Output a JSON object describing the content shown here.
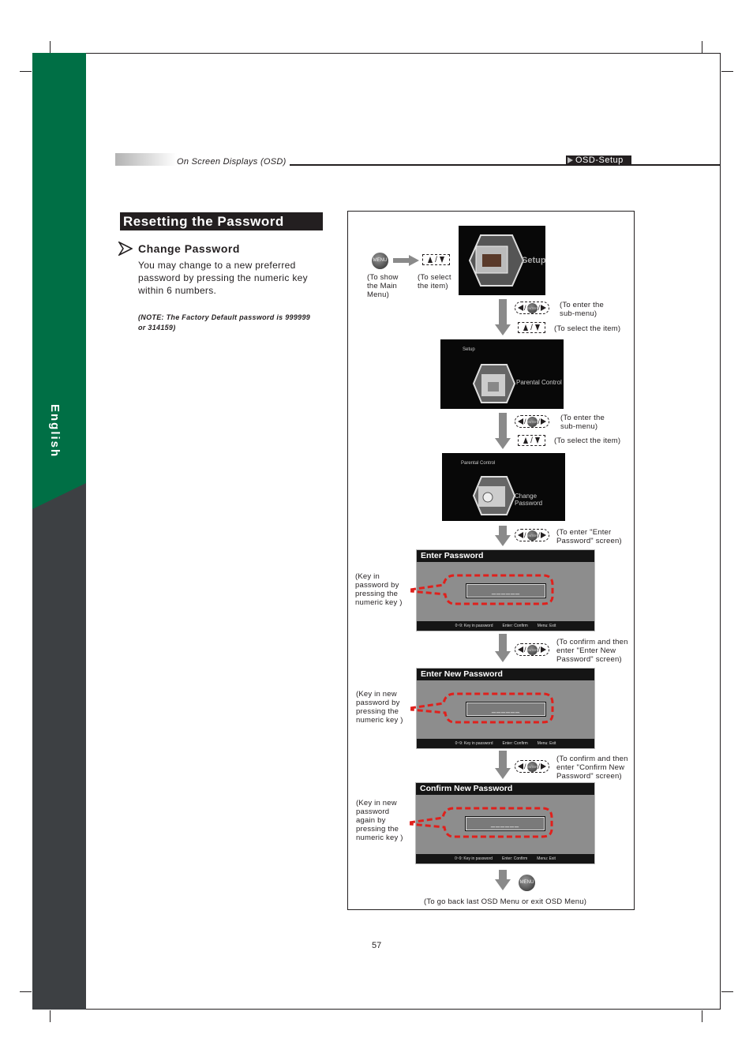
{
  "header": {
    "section": "On Screen Displays (OSD)",
    "tag": "OSD-Setup"
  },
  "sidebar": {
    "language": "English"
  },
  "colors": {
    "green": "#006f45",
    "dark": "#3d4043",
    "dashed_callout": "#e0201c"
  },
  "section": {
    "title": "Resetting the Password",
    "subtitle": "Change Password",
    "body": "You may change to a new preferred password by pressing the numeric key within 6 numbers.",
    "note": "(NOTE: The Factory Default password is 999999 or 314159)"
  },
  "diagram": {
    "menu_key": "MENU",
    "enter_key": "ENTER",
    "cap_show_main": "(To show the Main Menu)",
    "cap_select_item": "(To select the item)",
    "cap_enter_sub": "(To enter the sub-menu)",
    "cap_select_item2": "(To select the item)",
    "cap_enter_sub2": "(To enter the sub-menu)",
    "cap_select_item3": "(To select the item)",
    "cap_enter_pw": "(To enter \"Enter Password\" screen)",
    "cap_confirm_new": "(To confirm and then enter \"Enter New Password\" screen)",
    "cap_confirm_confirm": "(To confirm and then enter \"Confirm New Password\" screen)",
    "cap_exit": "(To go back last OSD Menu or exit OSD Menu)",
    "screens": {
      "setup": {
        "label": "Setup"
      },
      "parental": {
        "parent": "Setup",
        "label": "Parental Control"
      },
      "change": {
        "parent": "Parental Control",
        "label": "Change Password"
      }
    },
    "pw_screens": [
      {
        "title": "Enter Password",
        "callout": "(Key in password by pressing the numeric key )"
      },
      {
        "title": "Enter New Password",
        "callout": "(Key in new password by pressing the numeric key )"
      },
      {
        "title": "Confirm New Password",
        "callout": "(Key in new password again by pressing the numeric key )"
      }
    ],
    "pw_field": "______",
    "footer": {
      "keys": "0~9: Key in password",
      "confirm": "Enter: Confirm",
      "exit": "Menu: Exit"
    }
  },
  "page_number": "57"
}
